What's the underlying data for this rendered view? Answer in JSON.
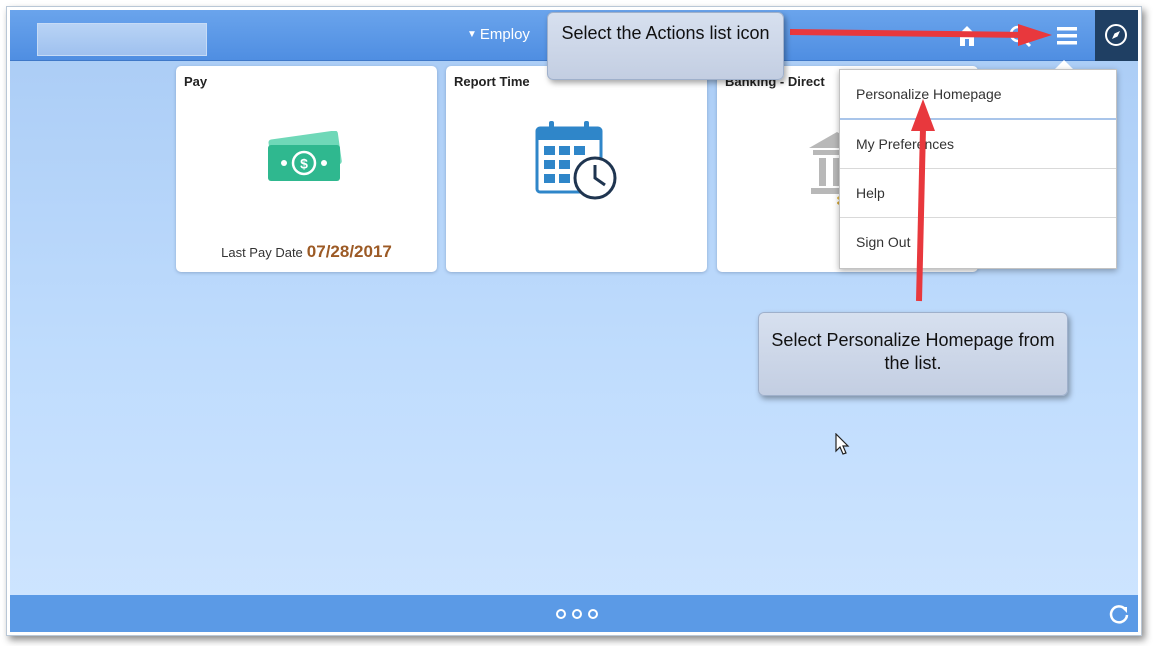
{
  "header": {
    "homepage_selector": "Employ",
    "icons": [
      "home-icon",
      "search-icon",
      "actions-list-icon",
      "navbar-icon"
    ]
  },
  "tiles": [
    {
      "title": "Pay",
      "footer_label": "Last Pay Date",
      "footer_value": "07/28/2017",
      "icon": "money-icon"
    },
    {
      "title": "Report Time",
      "icon": "calendar-clock-icon"
    },
    {
      "title": "Banking - Direct",
      "icon": "bank-icon"
    }
  ],
  "actions_menu": {
    "items": [
      {
        "label": "Personalize Homepage"
      },
      {
        "label": "My Preferences"
      },
      {
        "label": "Help"
      },
      {
        "label": "Sign Out"
      }
    ]
  },
  "callouts": {
    "actions": "Select the Actions list icon",
    "personalize": "Select Personalize Homepage from the list."
  },
  "footer": {
    "page_dots": 3,
    "active_page": 1
  },
  "colors": {
    "header": "#5b97e6",
    "background": "#bcdafc",
    "navbar": "#1f3f63",
    "pay_date": "#9c5a25",
    "annotation_arrow": "#e8383d"
  }
}
